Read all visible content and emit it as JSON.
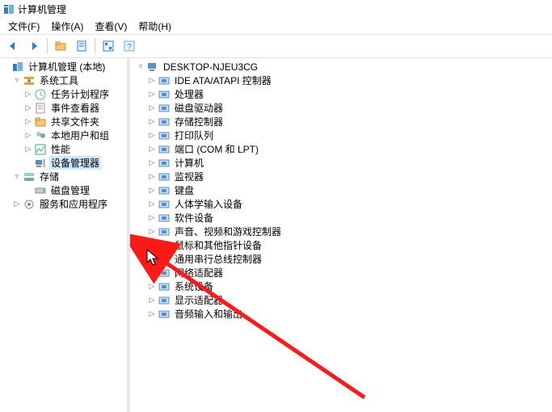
{
  "title": "计算机管理",
  "menu": {
    "file": "文件(F)",
    "action": "操作(A)",
    "view": "查看(V)",
    "help": "帮助(H)"
  },
  "toolbar": {
    "back": "后退",
    "forward": "前进",
    "up": "上移",
    "properties": "属性",
    "refresh": "刷新",
    "help": "帮助"
  },
  "leftTree": {
    "root": "计算机管理 (本地)",
    "systemTools": "系统工具",
    "taskScheduler": "任务计划程序",
    "eventViewer": "事件查看器",
    "sharedFolders": "共享文件夹",
    "localUsers": "本地用户和组",
    "performance": "性能",
    "deviceManager": "设备管理器",
    "storage": "存储",
    "diskMgmt": "磁盘管理",
    "services": "服务和应用程序"
  },
  "rightTree": {
    "host": "DESKTOP-NJEU3CG",
    "items": [
      "IDE ATA/ATAPI 控制器",
      "处理器",
      "磁盘驱动器",
      "存储控制器",
      "打印队列",
      "端口 (COM 和 LPT)",
      "计算机",
      "监视器",
      "键盘",
      "人体学输入设备",
      "软件设备",
      "声音、视频和游戏控制器",
      "鼠标和其他指针设备",
      "通用串行总线控制器",
      "网络适配器",
      "系统设备",
      "显示适配器",
      "音频输入和输出"
    ]
  },
  "iconNames": [
    "ide-controller-icon",
    "cpu-icon",
    "disk-drive-icon",
    "storage-controller-icon",
    "print-queue-icon",
    "port-icon",
    "computer-icon",
    "monitor-icon",
    "keyboard-icon",
    "hid-icon",
    "software-device-icon",
    "sound-icon",
    "mouse-icon",
    "usb-icon",
    "network-adapter-icon",
    "system-device-icon",
    "display-adapter-icon",
    "audio-io-icon"
  ]
}
